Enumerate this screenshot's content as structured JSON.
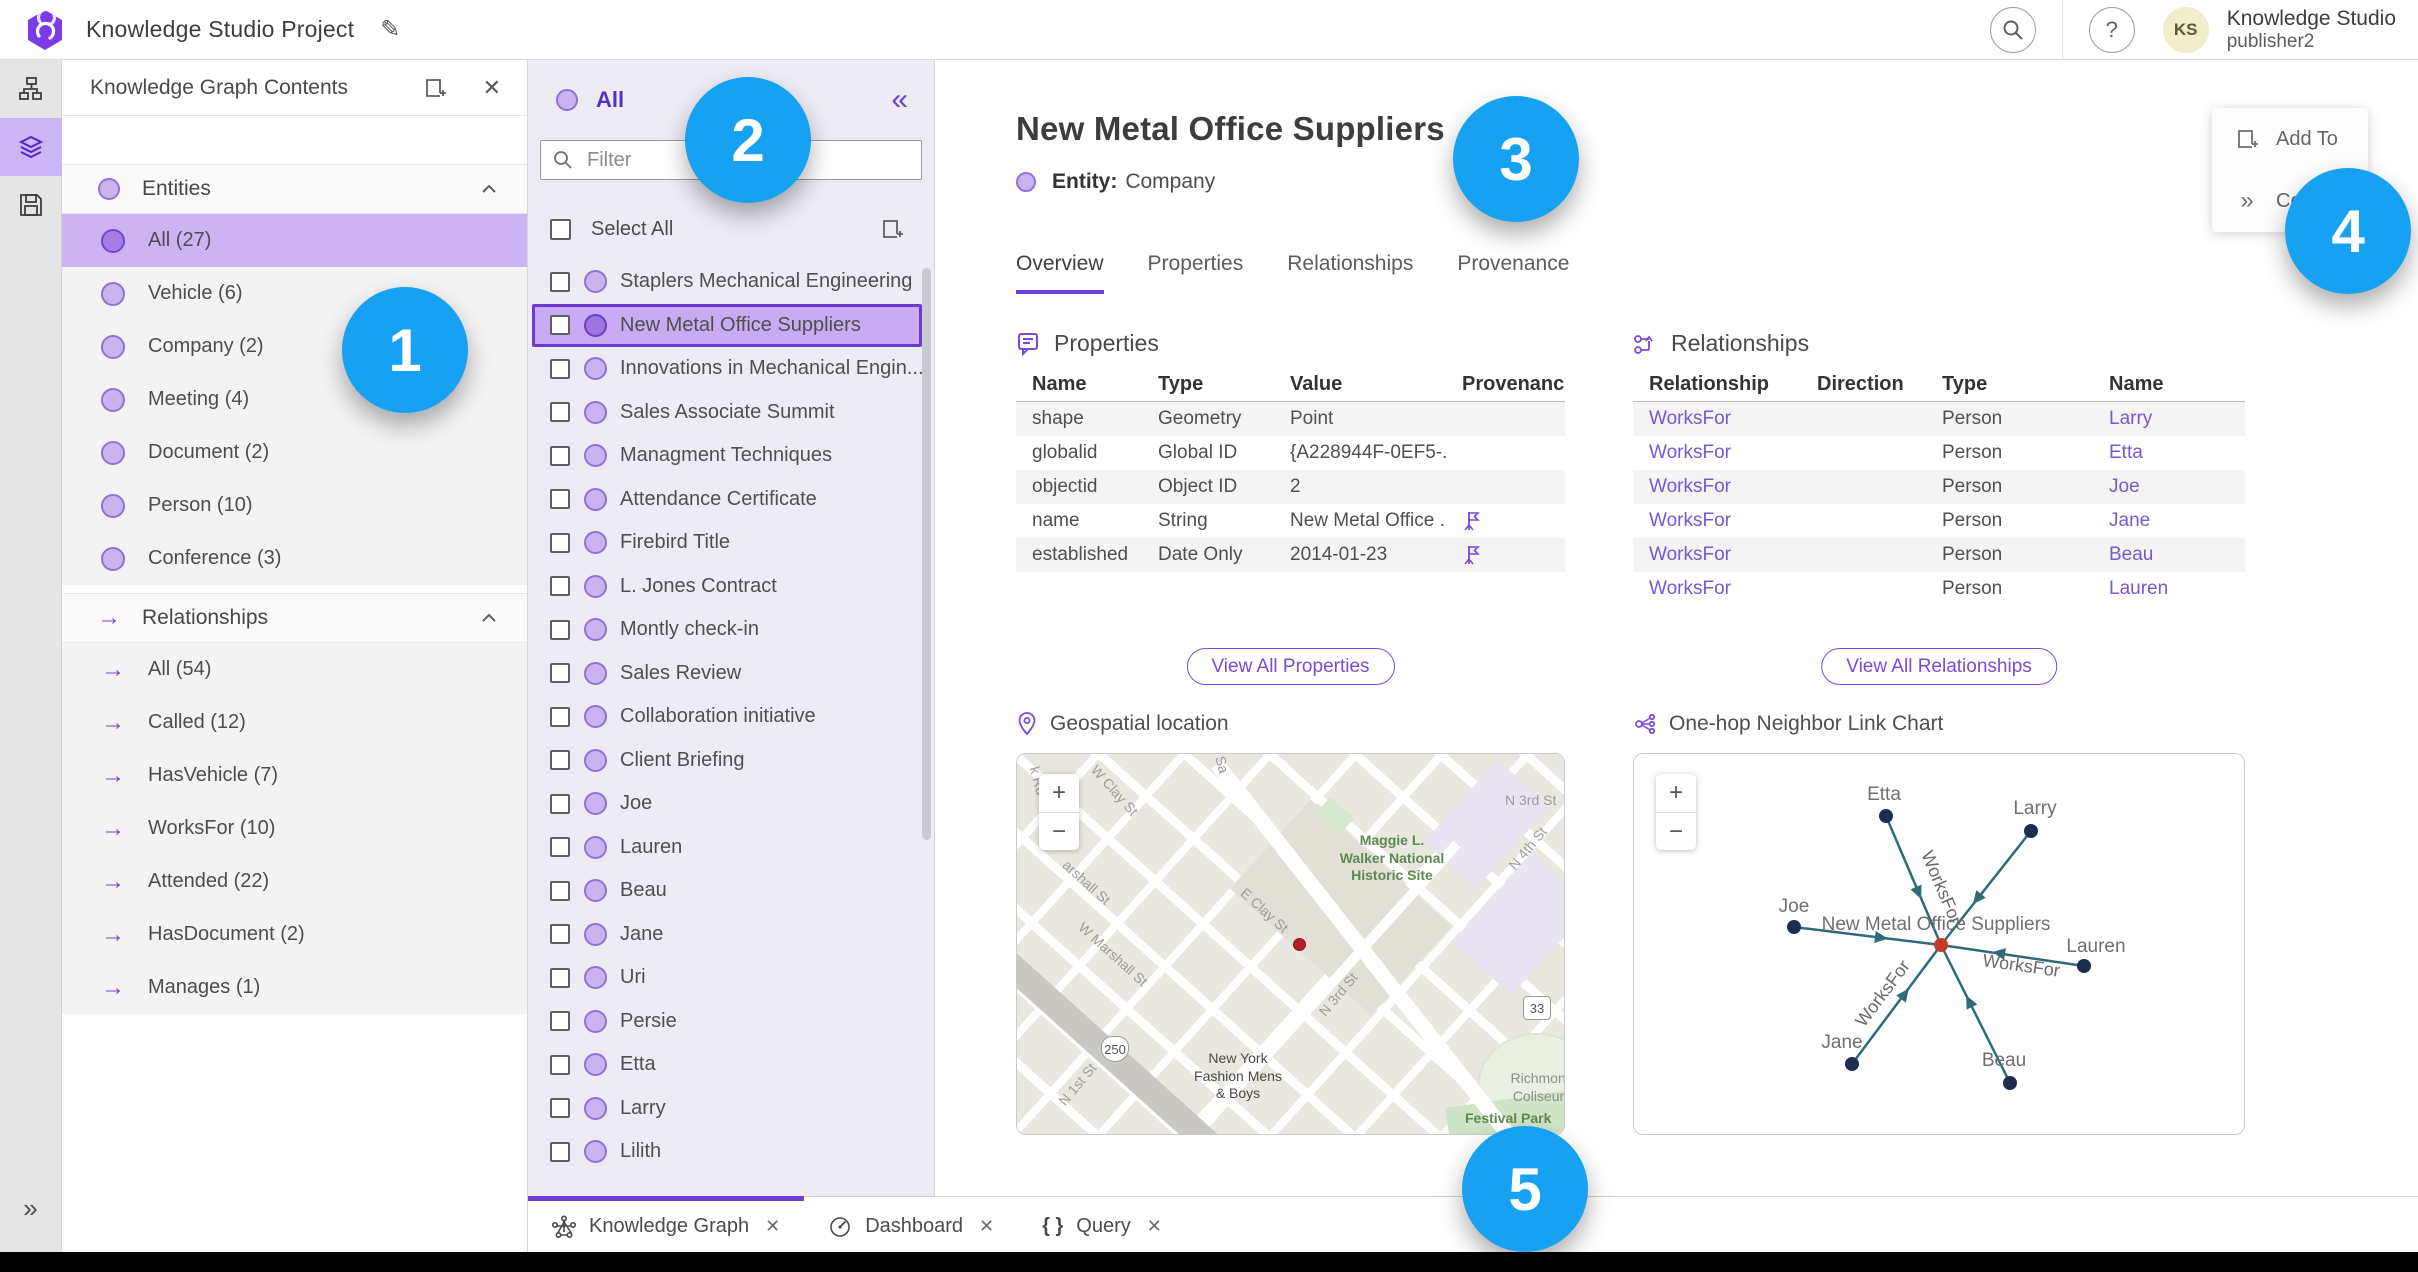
{
  "header": {
    "app_title": "Knowledge Studio Project",
    "org_name": "Knowledge Studio",
    "user_name": "publisher2",
    "avatar_initials": "KS"
  },
  "contents_panel": {
    "title": "Knowledge Graph Contents",
    "entities_label": "Entities",
    "relationships_label": "Relationships",
    "entities": [
      {
        "label": "All (27)",
        "selected": true
      },
      {
        "label": "Vehicle (6)"
      },
      {
        "label": "Company (2)"
      },
      {
        "label": "Meeting (4)"
      },
      {
        "label": "Document (2)"
      },
      {
        "label": "Person (10)"
      },
      {
        "label": "Conference (3)"
      }
    ],
    "relationships": [
      {
        "label": "All (54)"
      },
      {
        "label": "Called (12)"
      },
      {
        "label": "HasVehicle (7)"
      },
      {
        "label": "WorksFor (10)"
      },
      {
        "label": "Attended (22)"
      },
      {
        "label": "HasDocument (2)"
      },
      {
        "label": "Manages (1)"
      }
    ]
  },
  "list_panel": {
    "header": "All",
    "filter_placeholder": "Filter",
    "select_all_label": "Select All",
    "items": [
      {
        "label": "Staplers Mechanical Engineering"
      },
      {
        "label": "New Metal Office Suppliers",
        "selected": true
      },
      {
        "label": "Innovations in Mechanical Engin..."
      },
      {
        "label": "Sales Associate Summit"
      },
      {
        "label": "Managment Techniques"
      },
      {
        "label": "Attendance Certificate"
      },
      {
        "label": "Firebird Title"
      },
      {
        "label": "L. Jones Contract"
      },
      {
        "label": "Montly check-in"
      },
      {
        "label": "Sales Review"
      },
      {
        "label": "Collaboration initiative"
      },
      {
        "label": "Client Briefing"
      },
      {
        "label": "Joe"
      },
      {
        "label": "Lauren"
      },
      {
        "label": "Beau"
      },
      {
        "label": "Jane"
      },
      {
        "label": "Uri"
      },
      {
        "label": "Persie"
      },
      {
        "label": "Etta"
      },
      {
        "label": "Larry"
      },
      {
        "label": "Lilith"
      }
    ]
  },
  "detail": {
    "title": "New Metal Office Suppliers",
    "entity_type_label": "Entity:",
    "entity_type": "Company",
    "tabs": [
      "Overview",
      "Properties",
      "Relationships",
      "Provenance"
    ],
    "properties": {
      "heading": "Properties",
      "columns": [
        "Name",
        "Type",
        "Value",
        "Provenance"
      ],
      "rows": [
        {
          "name": "shape",
          "type": "Geometry",
          "value": "Point",
          "flag": false
        },
        {
          "name": "globalid",
          "type": "Global ID",
          "value": "{A228944F-0EF5-...",
          "flag": false
        },
        {
          "name": "objectid",
          "type": "Object ID",
          "value": "2",
          "flag": false
        },
        {
          "name": "name",
          "type": "String",
          "value": "New Metal Office ...",
          "flag": true
        },
        {
          "name": "established",
          "type": "Date Only",
          "value": "2014-01-23",
          "flag": true
        }
      ],
      "view_all": "View All Properties"
    },
    "relationships": {
      "heading": "Relationships",
      "columns": [
        "Relationship",
        "Direction",
        "Type",
        "Name"
      ],
      "rows": [
        {
          "relationship": "WorksFor",
          "direction": "←",
          "type": "Person",
          "name": "Larry"
        },
        {
          "relationship": "WorksFor",
          "direction": "←",
          "type": "Person",
          "name": "Etta"
        },
        {
          "relationship": "WorksFor",
          "direction": "←",
          "type": "Person",
          "name": "Joe"
        },
        {
          "relationship": "WorksFor",
          "direction": "←",
          "type": "Person",
          "name": "Jane"
        },
        {
          "relationship": "WorksFor",
          "direction": "←",
          "type": "Person",
          "name": "Beau"
        },
        {
          "relationship": "WorksFor",
          "direction": "←",
          "type": "Person",
          "name": "Lauren"
        }
      ],
      "view_all": "View All Relationships"
    },
    "map": {
      "heading": "Geospatial location",
      "labels": [
        "k Rd",
        "W Clay St",
        "Sa",
        "arshall St",
        "W Marshall St",
        "E Clay St",
        "N 3rd St",
        "N 1st St",
        "N 3rd St",
        "N 4th St",
        "Maggie L.\nWalker National\nHistoric Site",
        "New York\nFashion Mens\n& Boys",
        "Richmond\nColiseum",
        "Festival Park"
      ],
      "shields": [
        "250",
        "33"
      ]
    },
    "link_chart": {
      "heading": "One-hop Neighbor Link Chart",
      "center_label": "New Metal Office Suppliers",
      "edge_label": "WorksFor",
      "nodes": [
        {
          "name": "Etta"
        },
        {
          "name": "Larry"
        },
        {
          "name": "Joe"
        },
        {
          "name": "Lauren"
        },
        {
          "name": "Jane"
        },
        {
          "name": "Beau"
        }
      ]
    }
  },
  "floating_menu": {
    "add_to": "Add To",
    "collapse": "Colla"
  },
  "bottom_tabs": [
    {
      "label": "Knowledge Graph",
      "active": true
    },
    {
      "label": "Dashboard"
    },
    {
      "label": "Query"
    }
  ],
  "badges": [
    "1",
    "2",
    "3",
    "4",
    "5"
  ],
  "ui": {
    "close": "✕",
    "close_small": "✕",
    "collapse_left": "«",
    "expand_right": "»",
    "plus": "+",
    "minus": "−",
    "help": "?",
    "braces": "{ }",
    "edit": "✎"
  },
  "colors": {
    "accent_purple": "#6b3fd1",
    "selection_purple": "#c7abf3",
    "badge_blue": "#17a1f2",
    "edge_teal": "#2f6a78",
    "node_navy": "#1d2d50",
    "center_red": "#c43a2b",
    "marker_red": "#b32020"
  }
}
